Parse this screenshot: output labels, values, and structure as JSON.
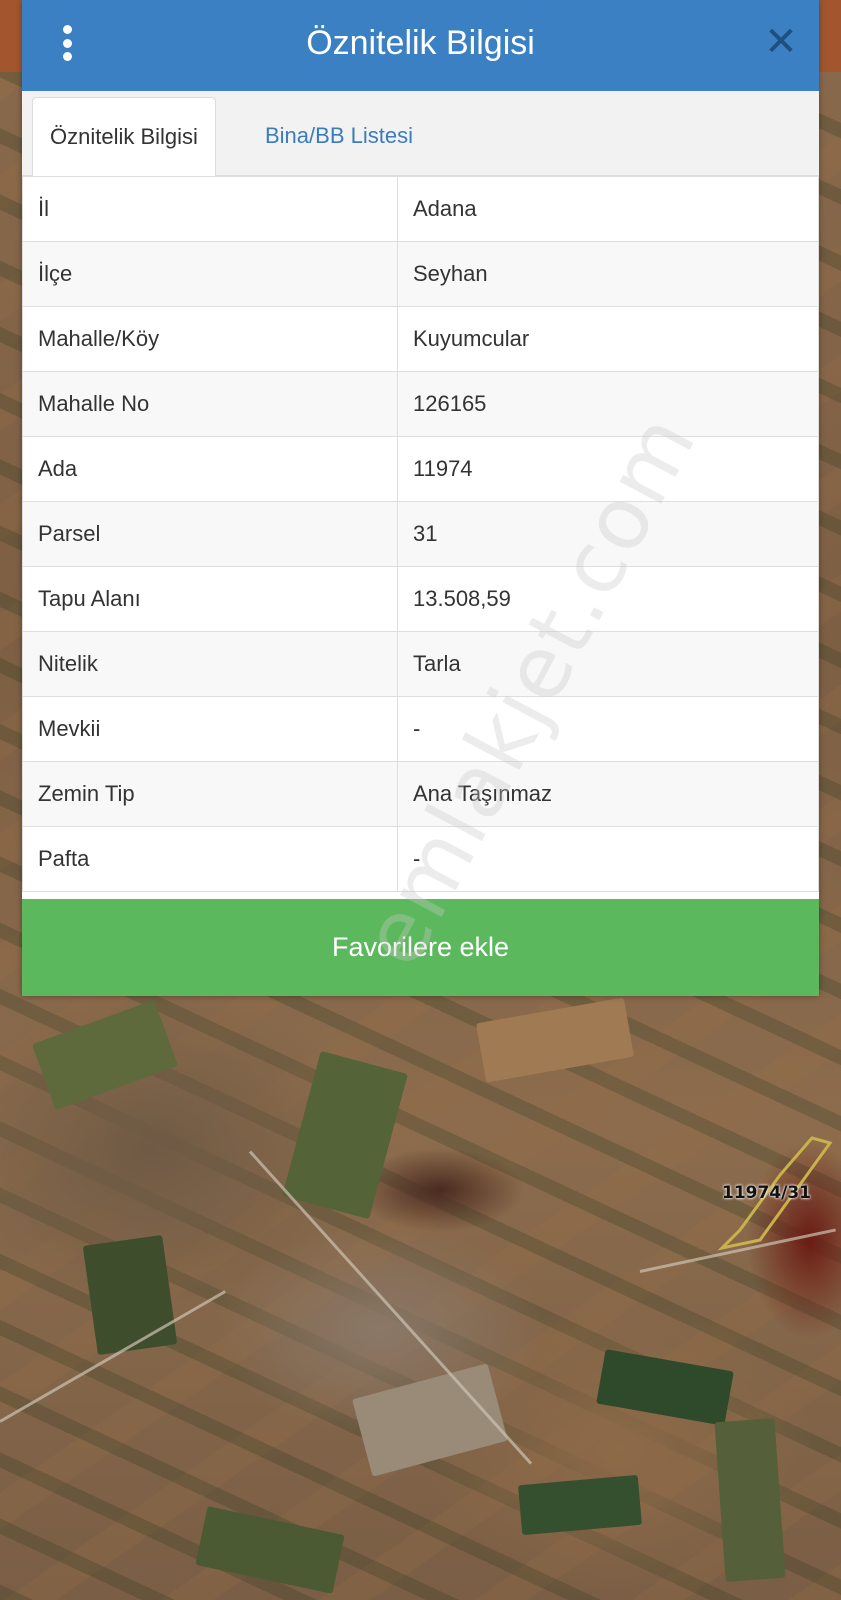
{
  "dialog": {
    "title": "Öznitelik Bilgisi",
    "menu_icon": "vertical-dots-icon",
    "close_icon": "close-icon"
  },
  "tabs": [
    {
      "label": "Öznitelik Bilgisi",
      "active": true
    },
    {
      "label": "Bina/BB Listesi",
      "active": false
    }
  ],
  "attributes": [
    {
      "key": "İl",
      "value": "Adana"
    },
    {
      "key": "İlçe",
      "value": "Seyhan"
    },
    {
      "key": "Mahalle/Köy",
      "value": "Kuyumcular"
    },
    {
      "key": "Mahalle No",
      "value": "126165"
    },
    {
      "key": "Ada",
      "value": "11974"
    },
    {
      "key": "Parsel",
      "value": "31"
    },
    {
      "key": "Tapu Alanı",
      "value": "13.508,59"
    },
    {
      "key": "Nitelik",
      "value": "Tarla"
    },
    {
      "key": "Mevkii",
      "value": "-"
    },
    {
      "key": "Zemin Tip",
      "value": "Ana Taşınmaz"
    },
    {
      "key": "Pafta",
      "value": "-"
    }
  ],
  "favorite_button_label": "Favorilere ekle",
  "map": {
    "parcel_label": "11974/31"
  },
  "watermark": "emlakjet.com",
  "colors": {
    "header": "#3b80c3",
    "tab_link": "#3b7cc0",
    "favorite_button": "#5cb85c",
    "close_icon": "#1f4f7e"
  }
}
